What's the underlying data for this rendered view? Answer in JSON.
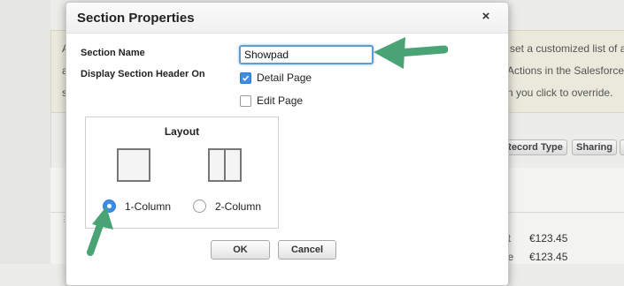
{
  "background": {
    "lines": [
      "set a customized list of a",
      "Actions in the Salesforce",
      "n you click to override."
    ],
    "pills": [
      "Record Type",
      "Sharing"
    ],
    "prices": [
      "€123.45",
      "€123.45"
    ],
    "label_fragments": [
      "nt",
      "ue"
    ],
    "left_fragments": [
      "A",
      "a",
      "s"
    ]
  },
  "dialog": {
    "title": "Section Properties",
    "close_glyph": "×",
    "section_name_label": "Section Name",
    "section_name_value": "Showpad",
    "display_header_label": "Display Section Header On",
    "options": {
      "detail_page": {
        "label": "Detail Page",
        "checked": true
      },
      "edit_page": {
        "label": "Edit Page",
        "checked": false
      }
    },
    "layout": {
      "title": "Layout",
      "one_column": "1-Column",
      "two_column": "2-Column",
      "selected": "1-Column"
    },
    "ok_label": "OK",
    "cancel_label": "Cancel"
  },
  "colors": {
    "accent": "#3b8ee3",
    "arrow": "#4aa374"
  }
}
